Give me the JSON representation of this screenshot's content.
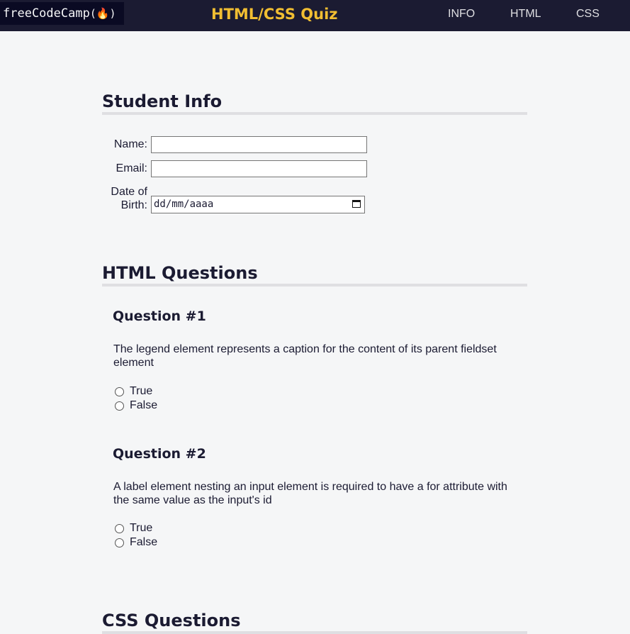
{
  "header": {
    "logo_text": "freeCodeCamp",
    "logo_flame": "(🔥)",
    "title": "HTML/CSS Quiz",
    "nav": [
      "INFO",
      "HTML",
      "CSS"
    ]
  },
  "student_info": {
    "heading": "Student Info",
    "name_label": "Name:",
    "email_label": "Email:",
    "dob_label_line1": "Date of",
    "dob_label_line2": "Birth:",
    "dob_placeholder": "dd/mm/aaaa",
    "name_value": "",
    "email_value": ""
  },
  "html_questions": {
    "heading": "HTML Questions",
    "questions": [
      {
        "title": "Question #1",
        "text": "The legend element represents a caption for the content of its parent fieldset element",
        "options": [
          "True",
          "False"
        ]
      },
      {
        "title": "Question #2",
        "text": "A label element nesting an input element is required to have a for attribute with the same value as the input's id",
        "options": [
          "True",
          "False"
        ]
      }
    ]
  },
  "css_questions": {
    "heading": "CSS Questions"
  },
  "colors": {
    "topbar": "#1b1b32",
    "title_accent": "#f1be32",
    "background": "#f5f6f7"
  }
}
